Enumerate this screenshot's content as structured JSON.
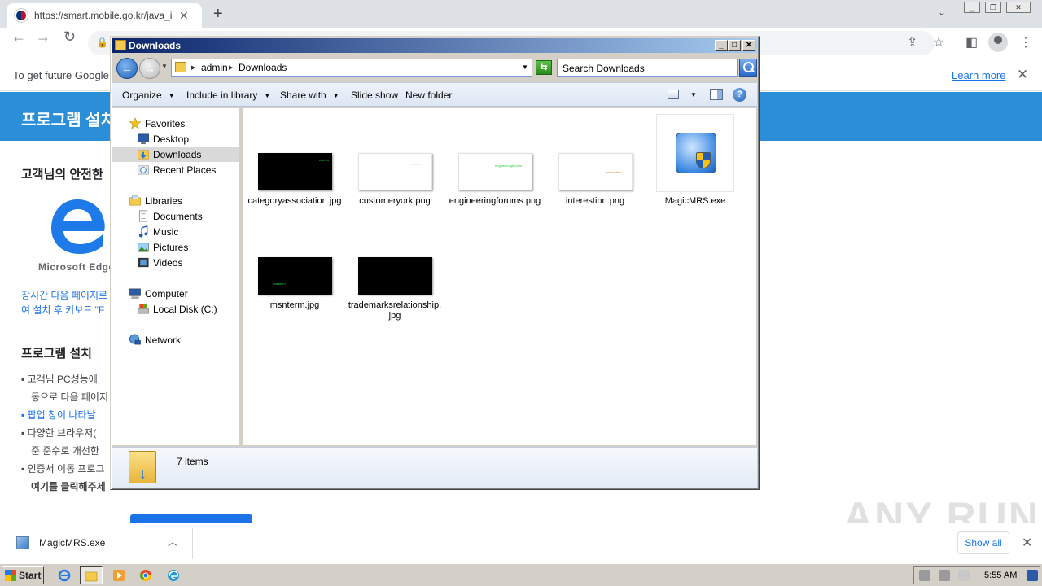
{
  "browser": {
    "tab_title": "https://smart.mobile.go.kr/java_inst",
    "tab_close": "✕",
    "new_tab": "+",
    "infobar_text": "To get future Google",
    "learn_more": "Learn more",
    "infobar_close": "✕"
  },
  "page": {
    "banner_title": "프로그램 설치",
    "heading1": "고객님의 안전한",
    "edge_logo_text": "Microsoft Edge",
    "blue_line1": "장시간 다음 페이지로",
    "blue_line2": "여 설치 후 키보드 \"F",
    "heading2": "프로그램 설치 ",
    "lines": [
      "▪ 고객님 PC성능에",
      "동으로 다음 페이지",
      "▪ 팝업 창이 나타날",
      "▪ 다양한 브라우저(",
      "준 준수로 개선한",
      "▪ 인증서 이동 프로그",
      "여기를 클릭해주세"
    ]
  },
  "downloads_shelf": {
    "file_name": "MagicMRS.exe",
    "show_all": "Show all",
    "close": "✕"
  },
  "watermark": "ANY RUN",
  "explorer": {
    "title": "Downloads",
    "address": {
      "segments": [
        "admin",
        "Downloads"
      ]
    },
    "search_placeholder": "Search Downloads",
    "toolbar": {
      "organize": "Organize",
      "include_in_library": "Include in library",
      "share_with": "Share with",
      "slide_show": "Slide show",
      "new_folder": "New folder"
    },
    "nav": {
      "favorites": "Favorites",
      "desktop": "Desktop",
      "downloads": "Downloads",
      "recent_places": "Recent Places",
      "libraries": "Libraries",
      "documents": "Documents",
      "music": "Music",
      "pictures": "Pictures",
      "videos": "Videos",
      "computer": "Computer",
      "local_disk": "Local Disk (C:)",
      "network": "Network"
    },
    "files": [
      {
        "name": "categoryassociation.jpg",
        "thumb": "dark",
        "thumb_text": "entries",
        "thumb_color": "#2ecc40"
      },
      {
        "name": "customeryork.png",
        "thumb": "light",
        "thumb_text": "———",
        "thumb_color": "#bbbbbb"
      },
      {
        "name": "engineeringforums.png",
        "thumb": "light",
        "thumb_text": "engineeringforums",
        "thumb_color": "#2ecc40"
      },
      {
        "name": "interestinn.png",
        "thumb": "light",
        "thumb_text": "interestinn",
        "thumb_color": "#e8833a"
      },
      {
        "name": "MagicMRS.exe",
        "thumb": "exe"
      },
      {
        "name": "msnterm.jpg",
        "thumb": "dark",
        "thumb_text": "msnterm",
        "thumb_color": "#2ecc40"
      },
      {
        "name": "trademarksrelationship.jpg",
        "thumb": "dark",
        "thumb_text": "",
        "thumb_color": "#2ecc40"
      }
    ],
    "item_count": "7 items"
  },
  "taskbar": {
    "start": "Start",
    "clock": "5:55 AM"
  }
}
